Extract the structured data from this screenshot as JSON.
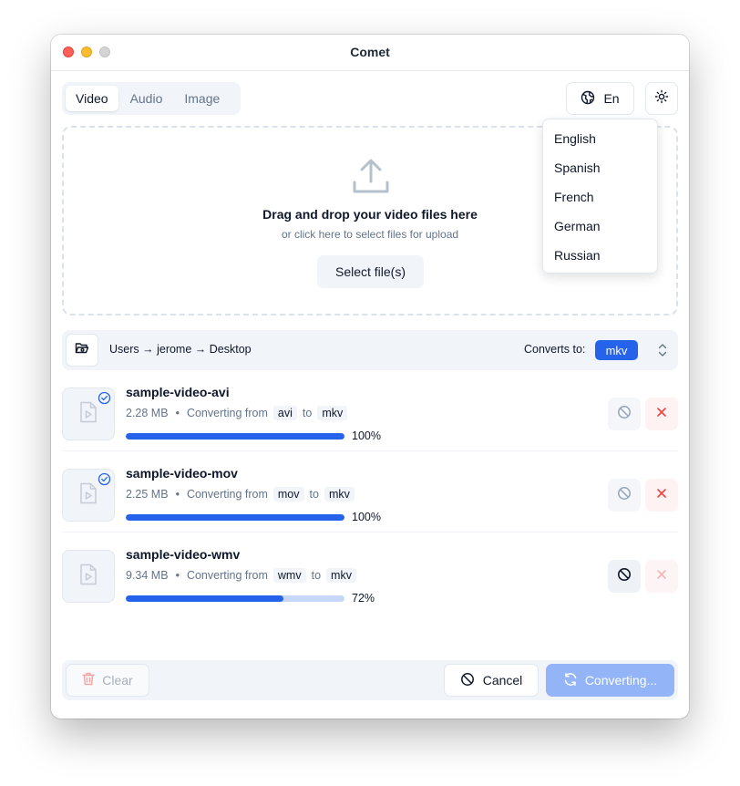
{
  "window": {
    "title": "Comet"
  },
  "tabs": [
    {
      "label": "Video",
      "active": true
    },
    {
      "label": "Audio",
      "active": false
    },
    {
      "label": "Image",
      "active": false
    }
  ],
  "header": {
    "language_button": "En",
    "language_icon": "globe-icon",
    "theme_icon": "sun-icon"
  },
  "language_menu": {
    "items": [
      "English",
      "Spanish",
      "French",
      "German",
      "Russian"
    ]
  },
  "dropzone": {
    "icon": "upload-icon",
    "title": "Drag and drop your video files here",
    "subtitle": "or click here to select files for upload",
    "button": "Select file(s)"
  },
  "pathbar": {
    "icon": "folder-open-icon",
    "path": "Users → jerome → Desktop",
    "converts_label": "Converts to:",
    "format": "mkv"
  },
  "files": [
    {
      "name": "sample-video-avi",
      "size": "2.28 MB",
      "converting_label": "Converting from",
      "from": "avi",
      "to_label": "to",
      "to": "mkv",
      "progress_label": "100%",
      "progress": 1.0,
      "done": true
    },
    {
      "name": "sample-video-mov",
      "size": "2.25 MB",
      "converting_label": "Converting from",
      "from": "mov",
      "to_label": "to",
      "to": "mkv",
      "progress_label": "100%",
      "progress": 1.0,
      "done": true
    },
    {
      "name": "sample-video-wmv",
      "size": "9.34 MB",
      "converting_label": "Converting from",
      "from": "wmv",
      "to_label": "to",
      "to": "mkv",
      "progress_label": "72%",
      "progress": 0.72,
      "done": false
    }
  ],
  "footer": {
    "clear": "Clear",
    "cancel": "Cancel",
    "converting": "Converting..."
  },
  "colors": {
    "accent": "#2563eb",
    "danger": "#ef4444",
    "muted": "#64748b"
  }
}
